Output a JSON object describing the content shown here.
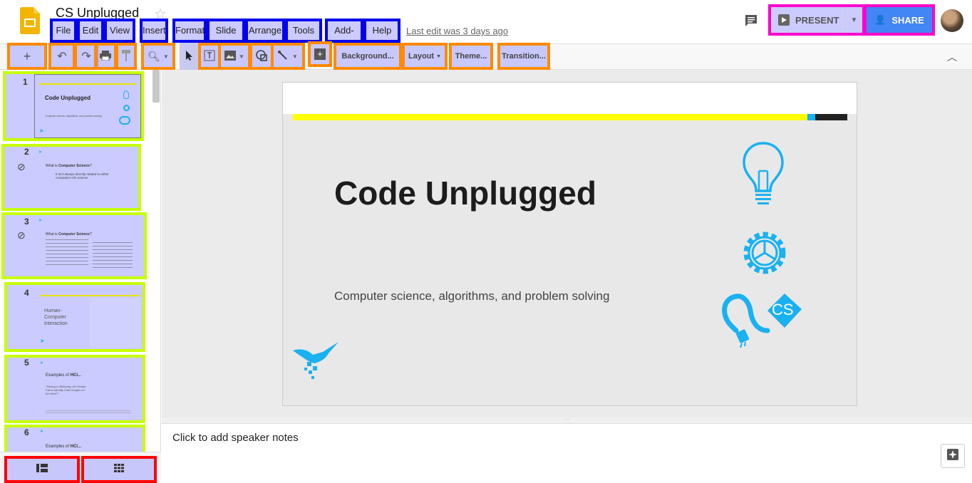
{
  "app": {
    "title": "CS Unplugged",
    "last_edit": "Last edit was 3 days ago"
  },
  "menu": [
    "File",
    "Edit",
    "View",
    "Insert",
    "Format",
    "Slide",
    "Arrange",
    "Tools",
    "Add-ons",
    "Help"
  ],
  "header": {
    "present_label": "PRESENT",
    "share_label": "SHARE"
  },
  "toolbar": {
    "background": "Background...",
    "layout": "Layout",
    "theme": "Theme...",
    "transition": "Transition..."
  },
  "slides": [
    {
      "num": "1",
      "title": "Code Unplugged",
      "subtitle": "Computer science, algorithms, and problem solving"
    },
    {
      "num": "2",
      "title_prefix": "What is ",
      "title_bold": "Computer Science",
      "title_suffix": "?",
      "body": "It isn't always directly related to either computers OR science"
    },
    {
      "num": "3",
      "title_prefix": "What is ",
      "title_bold": "Computer Science",
      "title_suffix": "?"
    },
    {
      "num": "4",
      "title": "Human-Computer Interaction"
    },
    {
      "num": "5",
      "title_prefix": "Examples of ",
      "title_bold": "HCI...",
      "body": "\"Seeing Is Believing: Do People Fail to Identify Fake Images on the Web?\""
    },
    {
      "num": "6",
      "title_prefix": "Examples of ",
      "title_bold": "HCI..."
    }
  ],
  "main_slide": {
    "title": "Code Unplugged",
    "subtitle": "Computer science, algorithms, and problem solving",
    "cs_badge": "CS"
  },
  "notes": {
    "placeholder": "Click to add speaker notes"
  },
  "colors": {
    "accent_yellow": "#ffff00",
    "accent_blue": "#1ab1f0",
    "brand_blue": "#4285f4"
  }
}
